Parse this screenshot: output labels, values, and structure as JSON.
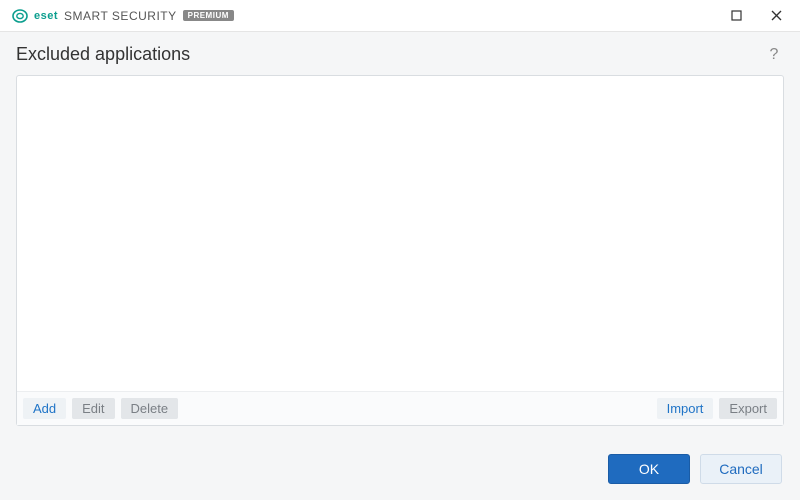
{
  "brand": {
    "eset": "eset",
    "product": "SMART SECURITY",
    "badge": "PREMIUM"
  },
  "page": {
    "title": "Excluded applications"
  },
  "actions": {
    "add": "Add",
    "edit": "Edit",
    "delete": "Delete",
    "import": "Import",
    "export": "Export"
  },
  "footer": {
    "ok": "OK",
    "cancel": "Cancel"
  },
  "list": {
    "items": []
  }
}
